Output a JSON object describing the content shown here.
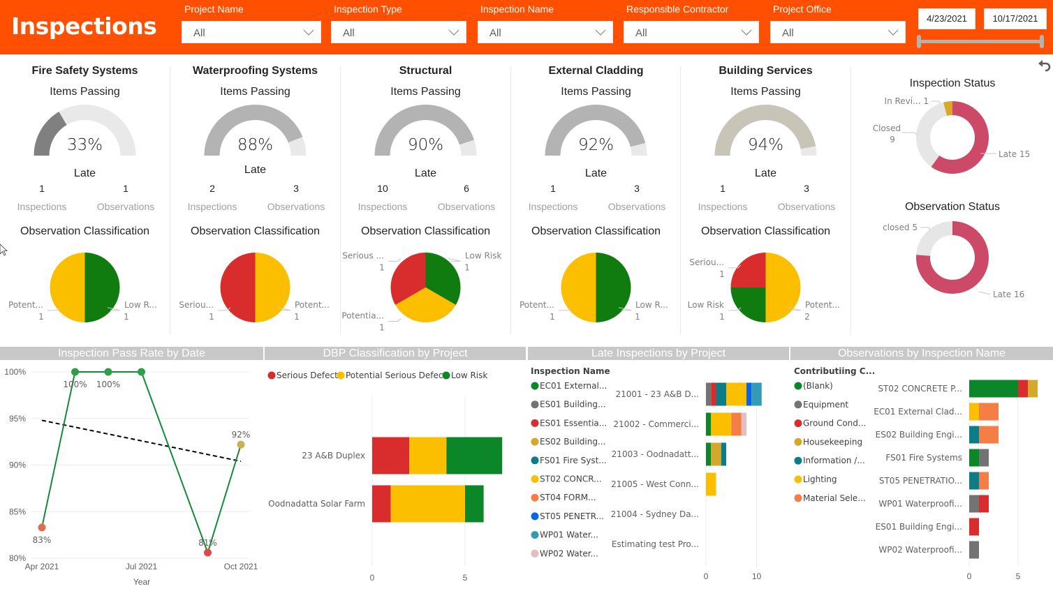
{
  "header": {
    "title": "Inspections",
    "slicers": [
      {
        "label": "Project Name",
        "value": "All"
      },
      {
        "label": "Inspection Type",
        "value": "All"
      },
      {
        "label": "Inspection Name",
        "value": "All"
      },
      {
        "label": "Responsible Contractor",
        "value": "All"
      },
      {
        "label": "Project Office",
        "value": "All"
      }
    ],
    "date_range": {
      "start": "4/23/2021",
      "end": "10/17/2021"
    },
    "icons": {
      "reset": "undo-arrow-icon",
      "dropdown": "chevron-down-icon"
    }
  },
  "categories": [
    {
      "title": "Fire Safety Systems",
      "gauge_label": "Items Passing",
      "pass_pct": 33,
      "pass_text": "33%",
      "gauge_color": "#808080",
      "late_label": "Late",
      "late_inspections": "1",
      "late_observations": "1",
      "inspections_label": "Inspections",
      "observations_label": "Observations",
      "classification_title": "Observation Classification",
      "pie": [
        {
          "name": "Low Risk",
          "label": "Low R...",
          "value": 1,
          "color": "#107c10"
        },
        {
          "name": "Potential Serious Defect",
          "label": "Potent...",
          "value": 1,
          "color": "#fbbf00"
        }
      ]
    },
    {
      "title": "Waterproofing Systems",
      "gauge_label": "Items Passing",
      "pass_pct": 88,
      "pass_text": "88%",
      "gauge_color": "#b3b3b3",
      "late_label": "Late",
      "late_inspections": "2",
      "late_observations": "3",
      "inspections_label": "Inspections",
      "observations_label": "Observations",
      "classification_title": "Observation Classification",
      "pie": [
        {
          "name": "Potential Serious Defect",
          "label": "Potent...",
          "value": 1,
          "color": "#fbbf00"
        },
        {
          "name": "Serious Defect",
          "label": "Seriou...",
          "value": 1,
          "color": "#d92d2d"
        }
      ]
    },
    {
      "title": "Structural",
      "gauge_label": "Items Passing",
      "pass_pct": 90,
      "pass_text": "90%",
      "gauge_color": "#b3b3b3",
      "late_label": "Late",
      "late_inspections": "10",
      "late_observations": "6",
      "inspections_label": "Inspections",
      "observations_label": "Observations",
      "classification_title": "Observation Classification",
      "pie": [
        {
          "name": "Low Risk",
          "label": "Low Risk",
          "value": 1,
          "color": "#107c10"
        },
        {
          "name": "Potential Serious Defect",
          "label": "Potentia...",
          "value": 1,
          "color": "#fbbf00"
        },
        {
          "name": "Serious Defect",
          "label": "Serious ...",
          "value": 1,
          "color": "#d92d2d"
        }
      ]
    },
    {
      "title": "External Cladding",
      "gauge_label": "Items Passing",
      "pass_pct": 92,
      "pass_text": "92%",
      "gauge_color": "#b3b3b3",
      "late_label": "Late",
      "late_inspections": "1",
      "late_observations": "3",
      "inspections_label": "Inspections",
      "observations_label": "Observations",
      "classification_title": "Observation Classification",
      "pie": [
        {
          "name": "Low Risk",
          "label": "Low R...",
          "value": 1,
          "color": "#107c10"
        },
        {
          "name": "Potential Serious Defect",
          "label": "Potent...",
          "value": 1,
          "color": "#fbbf00"
        }
      ]
    },
    {
      "title": "Building Services",
      "gauge_label": "Items Passing",
      "pass_pct": 94,
      "pass_text": "94%",
      "gauge_color": "#c8c5b8",
      "late_label": "Late",
      "late_inspections": "1",
      "late_observations": "3",
      "inspections_label": "Inspections",
      "observations_label": "Observations",
      "classification_title": "Observation Classification",
      "pie": [
        {
          "name": "Potential Serious Defect",
          "label": "Potent...",
          "value": 2,
          "color": "#fbbf00"
        },
        {
          "name": "Low Risk",
          "label": "Low Risk",
          "value": 1,
          "color": "#107c10"
        },
        {
          "name": "Serious Defect",
          "label": "Seriou...",
          "value": 1,
          "color": "#d92d2d"
        }
      ]
    }
  ],
  "inspection_status": {
    "title": "Inspection Status",
    "slices": [
      {
        "name": "Late",
        "label": "Late 15",
        "value": 15,
        "color": "#cc4a67"
      },
      {
        "name": "Closed",
        "label": "Closed",
        "value_text": "9",
        "value": 9,
        "color": "#e6e6e6"
      },
      {
        "name": "In Review",
        "label": "In Revi... 1",
        "value": 1,
        "color": "#d9a82a"
      }
    ]
  },
  "observation_status": {
    "title": "Observation Status",
    "slices": [
      {
        "name": "Late",
        "label": "Late 16",
        "value": 16,
        "color": "#cc4a67"
      },
      {
        "name": "closed",
        "label": "closed 5",
        "value": 5,
        "color": "#e6e6e6"
      }
    ]
  },
  "chart_data": [
    {
      "type": "line",
      "title": "Inspection Pass Rate by Date",
      "xlabel": "Year",
      "ylabel": "",
      "x_ticks": [
        "Apr 2021",
        "Jul 2021",
        "Oct 2021"
      ],
      "y_ticks": [
        "100%",
        "95%",
        "90%",
        "85%",
        "80%"
      ],
      "ylim": [
        80,
        100
      ],
      "x": [
        "Apr 2021",
        "May 2021",
        "Jun 2021",
        "Jul 2021",
        "Sep 2021",
        "Oct 2021"
      ],
      "x_month_index": [
        0.0,
        1.0,
        2.0,
        3.0,
        5.0,
        6.0
      ],
      "values": [
        83.3,
        100,
        100,
        100,
        80.6,
        92.2
      ],
      "data_labels": [
        "83%",
        "100%",
        "100%",
        "",
        "81%",
        "92%"
      ],
      "point_colors": [
        "#e06c51",
        "#2e9e47",
        "#2e9e47",
        "#2e9e47",
        "#e0474c",
        "#c4b454"
      ],
      "line_color": "#138a36",
      "trend": {
        "start": 94.8,
        "end": 90.4,
        "style": "dashed",
        "color": "#000000"
      },
      "grid": true
    },
    {
      "type": "bar",
      "orientation": "horizontal-stacked",
      "title": "DBP Classification by Project",
      "legend_position": "top-left",
      "categories": [
        "23 A&B Duplex",
        "Oodnadatta Solar Farm"
      ],
      "series": [
        {
          "name": "Serious Defect",
          "color": "#d92d2d",
          "values": [
            2,
            1
          ]
        },
        {
          "name": "Potential Serious Defect",
          "color": "#fbbf00",
          "values": [
            2,
            4
          ]
        },
        {
          "name": "Low Risk",
          "color": "#0b872a",
          "values": [
            3,
            1
          ]
        }
      ],
      "x_ticks": [
        0,
        5
      ],
      "xlim": [
        0,
        8.5
      ]
    },
    {
      "type": "bar",
      "orientation": "horizontal-stacked",
      "title": "Late Inspections by Project",
      "legend_title": "Inspection Name",
      "legend_position": "left",
      "categories": [
        "21001 - 23 A&B D...",
        "21002 - Commerci...",
        "21003 - Oodnadatt...",
        "21005 - West Conn...",
        "21004 - Sydney Da...",
        "Estimating test Pro..."
      ],
      "series": [
        {
          "name": "EC01 External...",
          "color": "#0b872a",
          "values": [
            0,
            1,
            1,
            0,
            0,
            0
          ]
        },
        {
          "name": "ES01 Building...",
          "color": "#737373",
          "values": [
            1,
            0,
            0,
            0,
            0,
            0
          ]
        },
        {
          "name": "ES01 Essentia...",
          "color": "#d92d2d",
          "values": [
            1,
            0,
            0,
            0,
            0,
            0
          ]
        },
        {
          "name": "ES02 Building...",
          "color": "#d4a82a",
          "values": [
            0,
            0,
            2,
            0,
            0,
            0
          ]
        },
        {
          "name": "FS01 Fire Syst...",
          "color": "#0a7d86",
          "values": [
            2,
            0,
            1,
            0,
            0,
            0
          ]
        },
        {
          "name": "ST02 CONCR...",
          "color": "#fbbf00",
          "values": [
            4,
            4,
            0,
            2,
            0,
            0
          ]
        },
        {
          "name": "ST04 FORM...",
          "color": "#f47e46",
          "values": [
            0,
            2,
            0,
            0,
            0,
            0
          ]
        },
        {
          "name": "ST05 PENETR...",
          "color": "#0766e3",
          "values": [
            1,
            0,
            0,
            0,
            0,
            0
          ]
        },
        {
          "name": "WP01 Water...",
          "color": "#3599b8",
          "values": [
            2,
            0,
            0,
            0,
            0,
            0
          ]
        },
        {
          "name": "WP02 Water...",
          "color": "#dfbfbf",
          "values": [
            0,
            1,
            0,
            0,
            0,
            0
          ]
        }
      ],
      "x_ticks": [
        0,
        10
      ],
      "xlim": [
        0,
        13
      ]
    },
    {
      "type": "bar",
      "orientation": "horizontal-stacked",
      "title": "Observations by Inspection Name",
      "legend_title": "Contributiing C...",
      "legend_position": "left",
      "categories": [
        "ST02 CONCRETE P...",
        "EC01 External Clad...",
        "ES02 Building Engi...",
        "FS01 Fire Systems",
        "ST05 PENETRATIO...",
        "WP01 Waterproofi...",
        "ES01 Building Engi...",
        "WP02 Waterproofi..."
      ],
      "series": [
        {
          "name": "(Blank)",
          "color": "#0b872a",
          "values": [
            5,
            0,
            0,
            1,
            0,
            0,
            0,
            0
          ]
        },
        {
          "name": "Equipment",
          "color": "#737373",
          "values": [
            0,
            0,
            0,
            1,
            0,
            1,
            0,
            1
          ]
        },
        {
          "name": "Ground Cond...",
          "color": "#d92d2d",
          "values": [
            1,
            0,
            0,
            0,
            0,
            1,
            1,
            0
          ]
        },
        {
          "name": "Housekeeping",
          "color": "#d4a82a",
          "values": [
            1,
            0,
            0,
            0,
            0,
            0,
            0,
            0
          ]
        },
        {
          "name": "Information /...",
          "color": "#0a7d86",
          "values": [
            0,
            0,
            1,
            0,
            1,
            0,
            0,
            0
          ]
        },
        {
          "name": "Lighting",
          "color": "#fbbf00",
          "values": [
            0,
            1,
            0,
            0,
            0,
            0,
            0,
            0
          ]
        },
        {
          "name": "Material Sele...",
          "color": "#f47e46",
          "values": [
            0,
            2,
            2,
            0,
            1,
            0,
            0,
            0
          ]
        }
      ],
      "x_ticks": [
        0,
        5
      ],
      "xlim": [
        0,
        8.5
      ]
    }
  ]
}
